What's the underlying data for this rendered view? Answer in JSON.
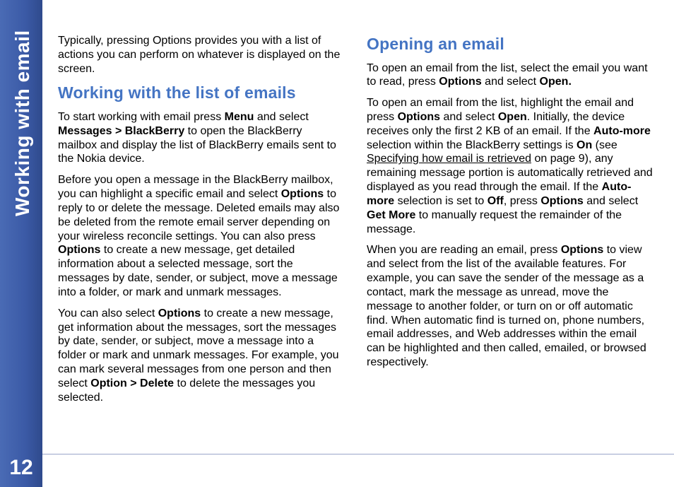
{
  "side": {
    "chapter_title": "Working with email",
    "page_number": "12"
  },
  "left_col": {
    "p_intro": "Typically, pressing Options provides you with a list of actions you can perform on whatever is displayed on the screen.",
    "h_list": "Working with the list of emails",
    "p1_a": "To start working with email press ",
    "p1_b1": "Menu",
    "p1_c": " and select ",
    "p1_b2": "Messages > BlackBerry",
    "p1_d": " to open the BlackBerry mailbox and display the list of BlackBerry emails sent to the Nokia device.",
    "p2_a": "Before you open a message in the BlackBerry mailbox, you can highlight a specific email and select ",
    "p2_b1": "Options",
    "p2_b": " to reply to or delete the message. Deleted emails may also be deleted from the remote email server depending on your wireless reconcile settings. You can also press ",
    "p2_b2": "Options",
    "p2_c": " to create a new message, get detailed information about a selected message, sort the messages by date, sender, or subject, move a message into a folder, or mark and unmark messages.",
    "p3_a": "You can also select ",
    "p3_b1": "Options",
    "p3_b": " to create a new message, get information about the messages, sort the messages by date, sender, or subject, move a message into a folder or mark and unmark messages. For example, you can mark several messages from one person and then select ",
    "p3_b2": "Option > Delete",
    "p3_c": " to delete the messages you selected."
  },
  "right_col": {
    "h_open": "Opening an email",
    "p1_a": "To open an email from the list, select the email you want to read, press ",
    "p1_b1": "Options",
    "p1_b": " and select ",
    "p1_b2": "Open.",
    "p2_a": "To open an email from the list, highlight the email and press ",
    "p2_b1": "Options",
    "p2_b": " and select ",
    "p2_b2": "Open",
    "p2_c": ". Initially, the device receives only the first 2 KB of an email. If the ",
    "p2_b3": "Auto-more",
    "p2_d": " selection within the BlackBerry settings is ",
    "p2_b4": "On",
    "p2_e": " (see ",
    "p2_link": "Specifying how email is retrieved",
    "p2_f": " on page 9), any remaining message portion is automatically retrieved and displayed as you read through the email. If the ",
    "p2_b5": "Auto-more",
    "p2_g": " selection is set to ",
    "p2_b6": "Off",
    "p2_h": ", press ",
    "p2_b7": "Options",
    "p2_i": " and select ",
    "p2_b8": "Get More",
    "p2_j": " to manually request the remainder of the message.",
    "p3_a": "When you are reading an email, press ",
    "p3_b1": "Options",
    "p3_b": " to view and select from the list of the available features. For example, you can save the sender of the message as a contact, mark the message as unread, move the message to another folder, or turn on or off automatic find. When automatic find is turned on, phone numbers, email addresses, and Web addresses within the email can be highlighted and then called, emailed, or browsed respectively."
  }
}
